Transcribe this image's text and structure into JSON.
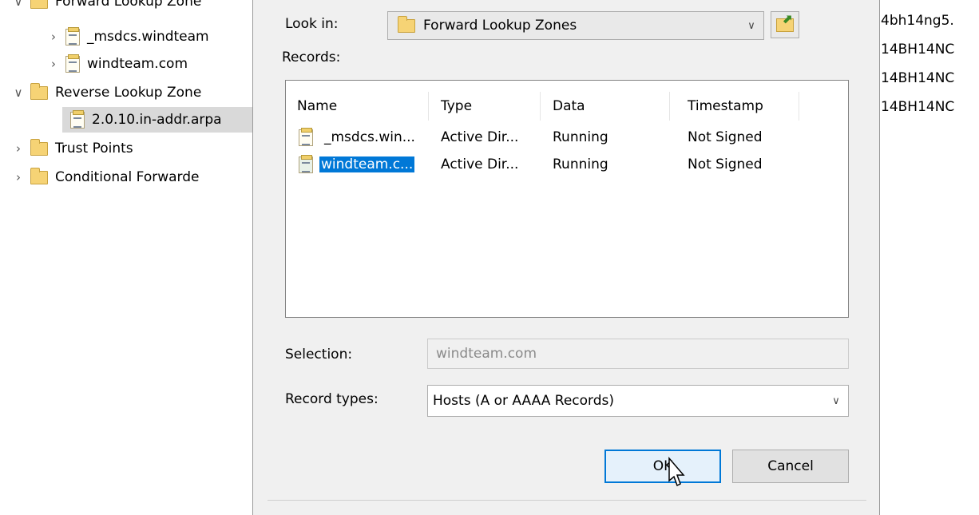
{
  "tree": {
    "items": [
      {
        "label": "Forward Lookup Zone",
        "chevron": "∨",
        "icon": "folder"
      },
      {
        "label": "_msdcs.windteam",
        "chevron": "›",
        "icon": "zone"
      },
      {
        "label": "windteam.com",
        "chevron": "›",
        "icon": "zone"
      },
      {
        "label": "Reverse Lookup Zone",
        "chevron": "∨",
        "icon": "folder"
      },
      {
        "label": "2.0.10.in-addr.arpa",
        "chevron": "",
        "icon": "zone"
      },
      {
        "label": "Trust Points",
        "chevron": "›",
        "icon": "folder"
      },
      {
        "label": "Conditional Forwarde",
        "chevron": "›",
        "icon": "folder"
      }
    ]
  },
  "dialog": {
    "look_in_label": "Look in:",
    "look_in_value": "Forward Lookup Zones",
    "records_label": "Records:",
    "columns": [
      "Name",
      "Type",
      "Data",
      "Timestamp"
    ],
    "rows": [
      {
        "name": "_msdcs.win...",
        "type": "Active Dir...",
        "data": "Running",
        "timestamp": "Not Signed"
      },
      {
        "name": "windteam.c...",
        "type": "Active Dir...",
        "data": "Running",
        "timestamp": "Not Signed"
      }
    ],
    "selection_label": "Selection:",
    "selection_value": "windteam.com",
    "record_types_label": "Record types:",
    "record_types_value": "Hosts (A or AAAA Records)",
    "ok_label": "OK",
    "cancel_label": "Cancel"
  },
  "right_pane": {
    "lines": [
      "4bh14ng5.",
      "14BH14NC",
      "14BH14NC",
      "14BH14NC"
    ]
  },
  "colors": {
    "selection": "#0078d7",
    "dialog_bg": "#f0f0f0",
    "folder": "#f6d375"
  }
}
